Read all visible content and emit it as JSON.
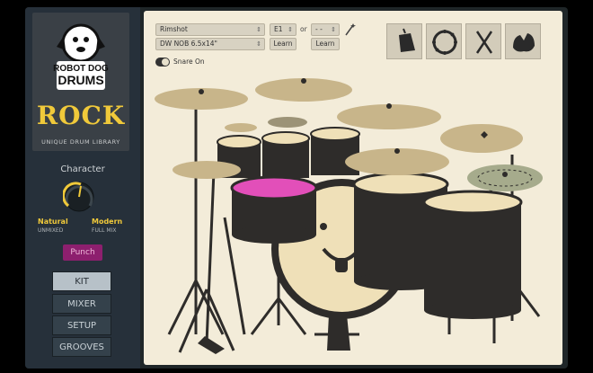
{
  "brand": {
    "line1": "ROBOT DOG",
    "line2": "DRUMS",
    "title": "ROCK",
    "tagline": "UNIQUE DRUM LIBRARY"
  },
  "character": {
    "label": "Character",
    "left_label": "Natural",
    "left_sub": "UNMIXED",
    "right_label": "Modern",
    "right_sub": "FULL MIX"
  },
  "punch_label": "Punch",
  "nav": {
    "kit": "KIT",
    "mixer": "MIXER",
    "setup": "SETUP",
    "grooves": "GROOVES",
    "active": "KIT"
  },
  "controls": {
    "articulation": "Rimshot",
    "note": "E1",
    "or": "or",
    "note2": "- -",
    "drum": "DW NOB 6.5x14\"",
    "learn1": "Learn",
    "learn2": "Learn",
    "snare_on": "Snare On"
  },
  "icons": [
    "cowbell-icon",
    "tambourine-icon",
    "sticks-icon",
    "hands-icon"
  ],
  "colors": {
    "accent_gold": "#f0c93a",
    "punch": "#8d1f6e",
    "highlight_pink": "#e24fb9",
    "cymbal": "#c8b58a",
    "drum_shell": "#2e2c2a"
  }
}
